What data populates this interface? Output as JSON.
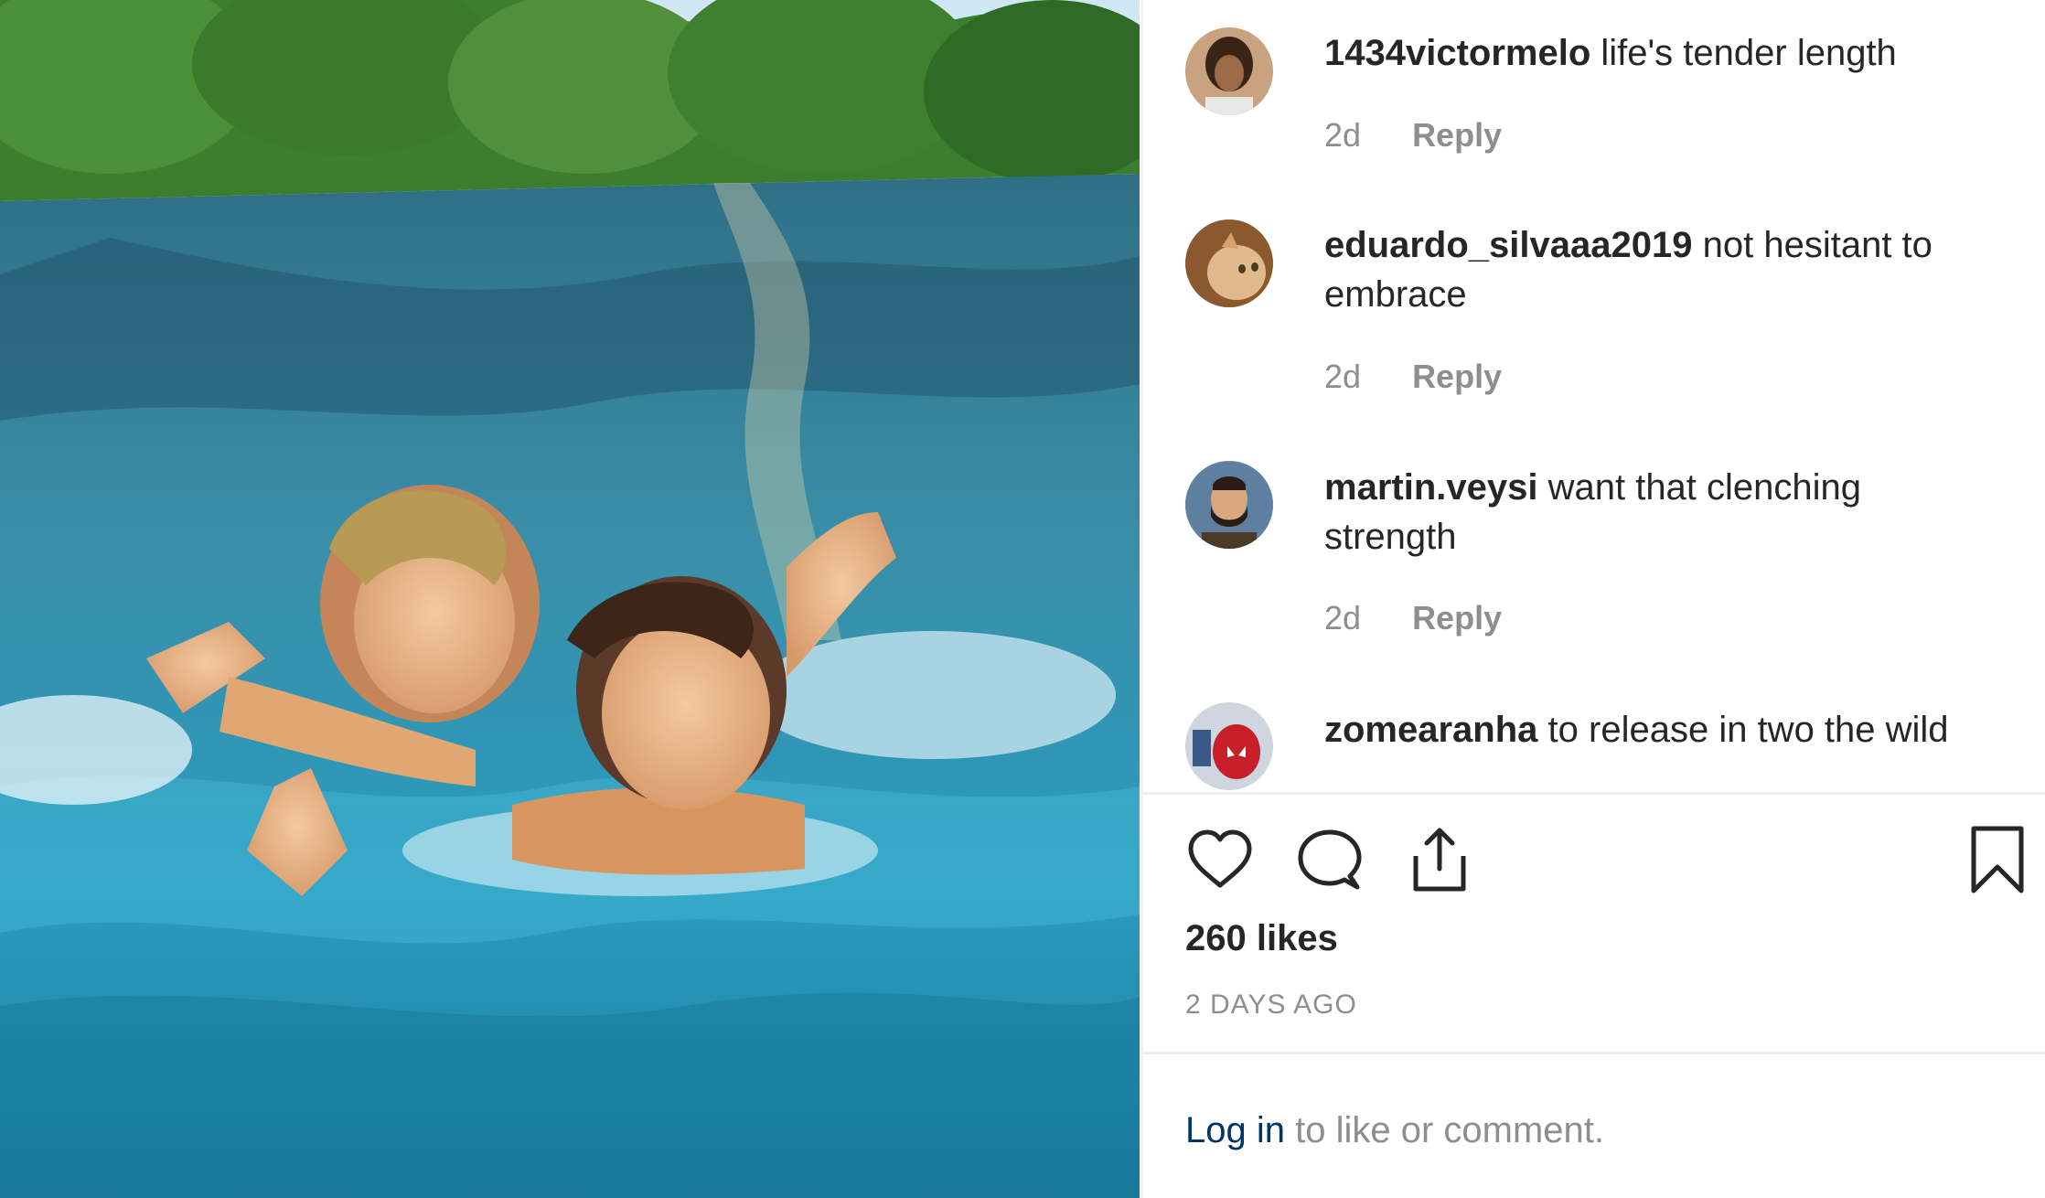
{
  "comments": [
    {
      "username": "1434victormelo",
      "text": "life's tender length",
      "time": "2d",
      "reply": "Reply"
    },
    {
      "username": "eduardo_silvaaa2019",
      "text": "not hesitant to embrace",
      "time": "2d",
      "reply": "Reply"
    },
    {
      "username": "martin.veysi",
      "text": "want that clenching strength",
      "time": "2d",
      "reply": "Reply"
    },
    {
      "username": "zomearanha",
      "text": "to release in two the wild"
    }
  ],
  "actions": {
    "like": "heart-icon",
    "comment": "comment-bubble-icon",
    "share": "share-icon",
    "save": "bookmark-icon"
  },
  "likes": "260 likes",
  "posted": "2 DAYS AGO",
  "login": {
    "link": "Log in",
    "rest": " to like or comment."
  },
  "colors": {
    "text": "#262626",
    "muted": "#8e8e8e",
    "link": "#003569",
    "divider": "#efefef"
  }
}
